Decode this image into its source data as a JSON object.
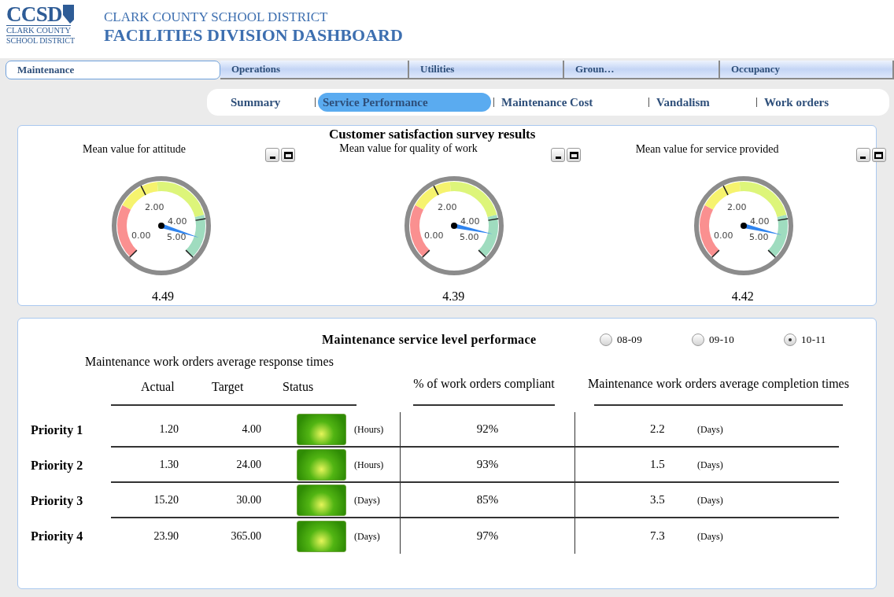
{
  "header": {
    "logo_mark": "CCSD",
    "logo_line1": "CLARK COUNTY",
    "logo_line2": "SCHOOL DISTRICT",
    "org": "CLARK COUNTY SCHOOL DISTRICT",
    "title": "FACILITIES DIVISION DASHBOARD"
  },
  "tabs": [
    {
      "label": "Maintenance",
      "selected": true
    },
    {
      "label": "Operations",
      "selected": false
    },
    {
      "label": "Utilities",
      "selected": false
    },
    {
      "label": "Groun…",
      "selected": false
    },
    {
      "label": "Occupancy",
      "selected": false
    }
  ],
  "subtabs": [
    {
      "label": "Summary",
      "selected": false
    },
    {
      "label": "Service Performance",
      "selected": true
    },
    {
      "label": "Maintenance Cost",
      "selected": false
    },
    {
      "label": "Vandalism",
      "selected": false
    },
    {
      "label": "Work orders",
      "selected": false
    }
  ],
  "survey": {
    "title": "Customer satisfaction survey results",
    "gauges": [
      {
        "title": "Mean value for attitude",
        "ticks": [
          "0.00",
          "2.00",
          "4.00",
          "5.00"
        ],
        "value": "4.49"
      },
      {
        "title": "Mean value for quality of work",
        "ticks": [
          "0.00",
          "2.00",
          "4.00",
          "5.00"
        ],
        "value": "4.39"
      },
      {
        "title": "Mean value for service provided",
        "ticks": [
          "0.00",
          "2.00",
          "4.00",
          "5.00"
        ],
        "value": "4.42"
      }
    ]
  },
  "performance": {
    "title": "Maintenance service level performace",
    "years": [
      {
        "label": "08-09",
        "selected": false
      },
      {
        "label": "09-10",
        "selected": false
      },
      {
        "label": "10-11",
        "selected": true
      }
    ],
    "response_title": "Maintenance work orders average response times",
    "columns": [
      "Actual",
      "Target",
      "Status",
      "% of work orders compliant",
      "Maintenance work orders average completion times"
    ],
    "rows": [
      {
        "priority": "Priority 1",
        "actual": "1.20",
        "target": "4.00",
        "unit": "(Hours)",
        "compliant": "92%",
        "completion": "2.2",
        "completion_unit": "(Days)"
      },
      {
        "priority": "Priority 2",
        "actual": "1.30",
        "target": "24.00",
        "unit": "(Hours)",
        "compliant": "93%",
        "completion": "1.5",
        "completion_unit": "(Days)"
      },
      {
        "priority": "Priority 3",
        "actual": "15.20",
        "target": "30.00",
        "unit": "(Days)",
        "compliant": "85%",
        "completion": "3.5",
        "completion_unit": "(Days)"
      },
      {
        "priority": "Priority 4",
        "actual": "23.90",
        "target": "365.00",
        "unit": "(Days)",
        "compliant": "97%",
        "completion": "7.3",
        "completion_unit": "(Days)"
      }
    ]
  }
}
